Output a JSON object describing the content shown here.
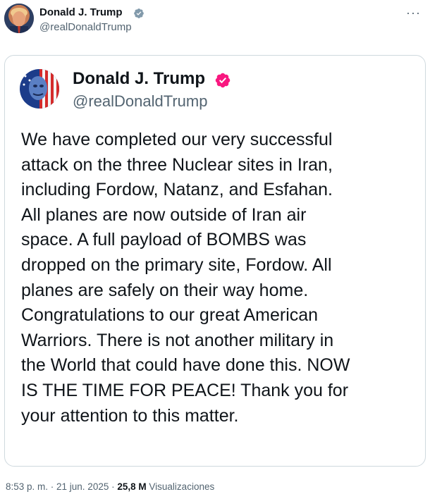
{
  "post": {
    "author_name": "Donald J. Trump",
    "author_handle": "@realDonaldTrump",
    "more_icon": "more-horizontal-icon",
    "timestamp": "8:53 p. m. · 21 jun. 2025",
    "separator": " · ",
    "views_count": "25,8 M",
    "views_label": "Visualizaciones"
  },
  "embedded": {
    "author_name": "Donald J. Trump",
    "author_handle": "@realDonaldTrump",
    "body": "We have completed our very successful\nattack on the three Nuclear sites in Iran,\nincluding Fordow, Natanz, and Esfahan.\nAll planes are now outside of Iran air\nspace. A full payload of BOMBS was\ndropped on the primary site, Fordow. All\nplanes are safely on their way home.\nCongratulations to our great American\nWarriors. There is not another military in\nthe World that could have done this. NOW\nIS THE TIME FOR PEACE! Thank you for\nyour attention to this matter."
  },
  "colors": {
    "verified_small": "#1d9bf0",
    "verified_big": "#f91880",
    "text": "#0f1419",
    "secondary": "#536471",
    "border": "#cfd9de"
  }
}
